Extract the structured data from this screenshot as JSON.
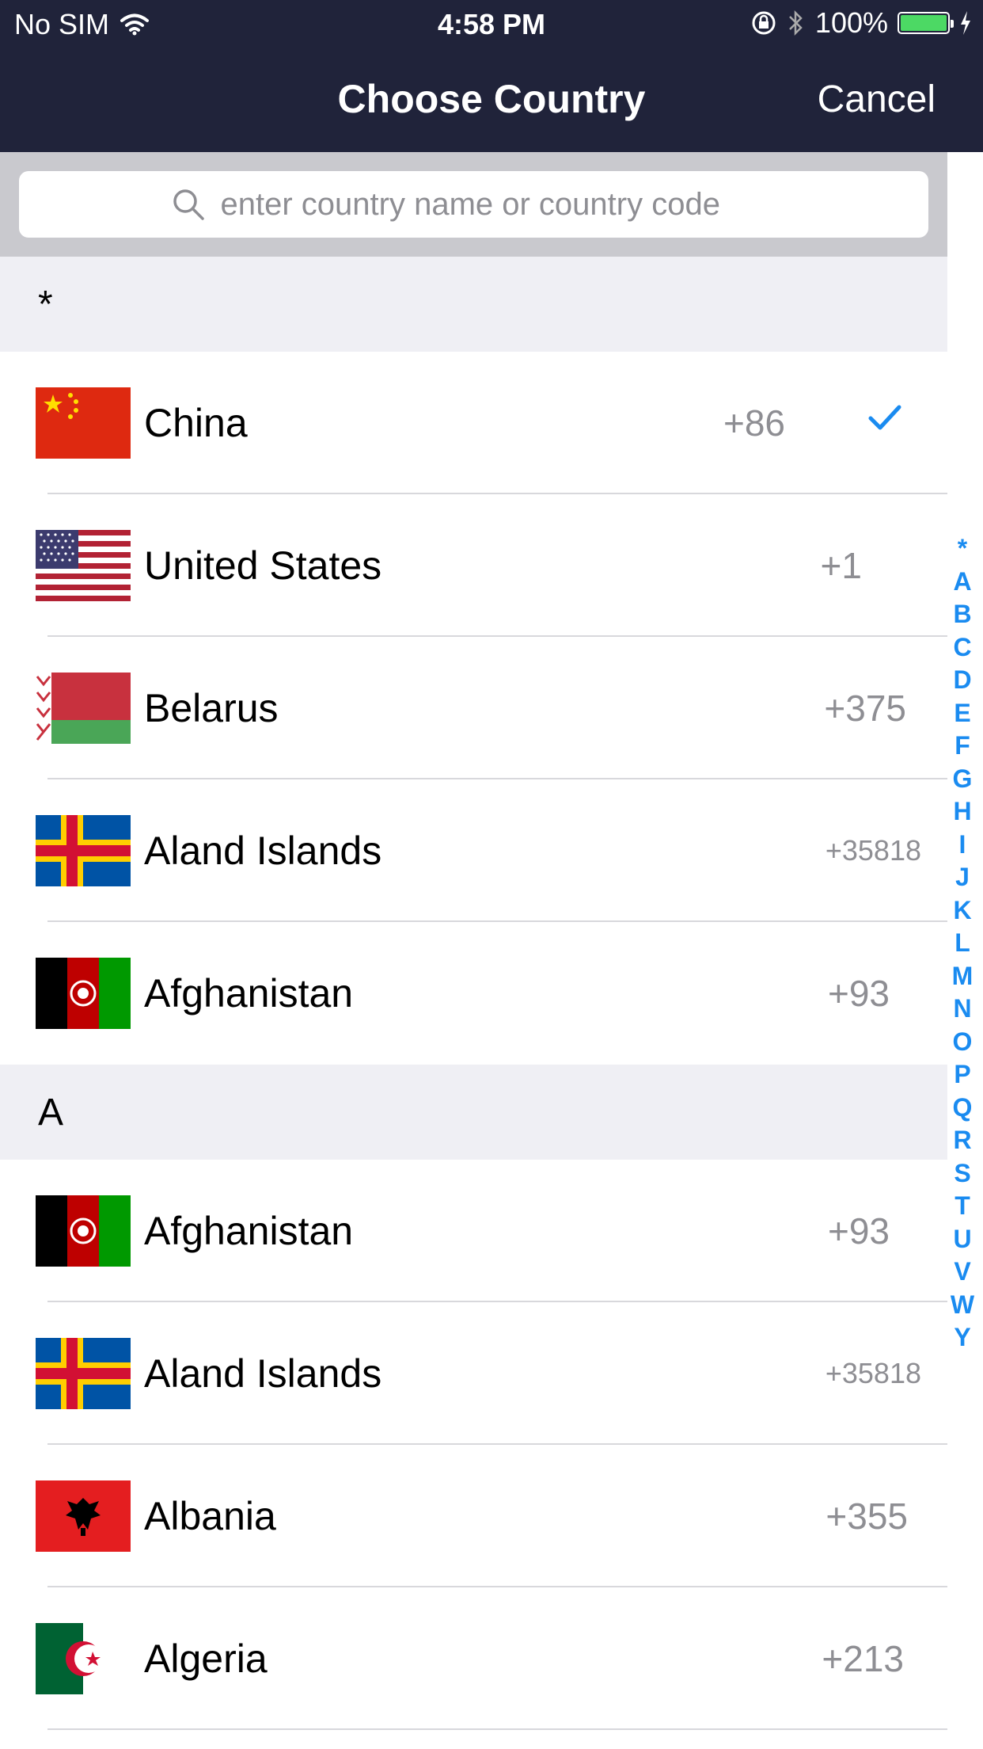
{
  "status_bar": {
    "carrier": "No SIM",
    "time": "4:58 PM",
    "battery": "100%"
  },
  "nav": {
    "title": "Choose Country",
    "cancel_label": "Cancel"
  },
  "search": {
    "placeholder": "enter country name or country code"
  },
  "sections": [
    {
      "header": "*",
      "rows": [
        {
          "name": "China",
          "code": "+86",
          "flag": "cn",
          "selected": true
        },
        {
          "name": "United States",
          "code": "+1",
          "flag": "us"
        },
        {
          "name": "Belarus",
          "code": "+375",
          "flag": "by"
        },
        {
          "name": "Aland Islands",
          "code": "+35818",
          "flag": "ax"
        },
        {
          "name": "Afghanistan",
          "code": "+93",
          "flag": "af"
        }
      ]
    },
    {
      "header": "A",
      "rows": [
        {
          "name": "Afghanistan",
          "code": "+93",
          "flag": "af"
        },
        {
          "name": "Aland Islands",
          "code": "+35818",
          "flag": "ax"
        },
        {
          "name": "Albania",
          "code": "+355",
          "flag": "al"
        },
        {
          "name": "Algeria",
          "code": "+213",
          "flag": "dz"
        }
      ]
    }
  ],
  "index_letters": [
    "*",
    "A",
    "B",
    "C",
    "D",
    "E",
    "F",
    "G",
    "H",
    "I",
    "J",
    "K",
    "L",
    "M",
    "N",
    "O",
    "P",
    "Q",
    "R",
    "S",
    "T",
    "U",
    "V",
    "W",
    "Y"
  ],
  "colors": {
    "nav_bg": "#20233a",
    "accent": "#1a8bf0",
    "battery": "#4cd964"
  }
}
